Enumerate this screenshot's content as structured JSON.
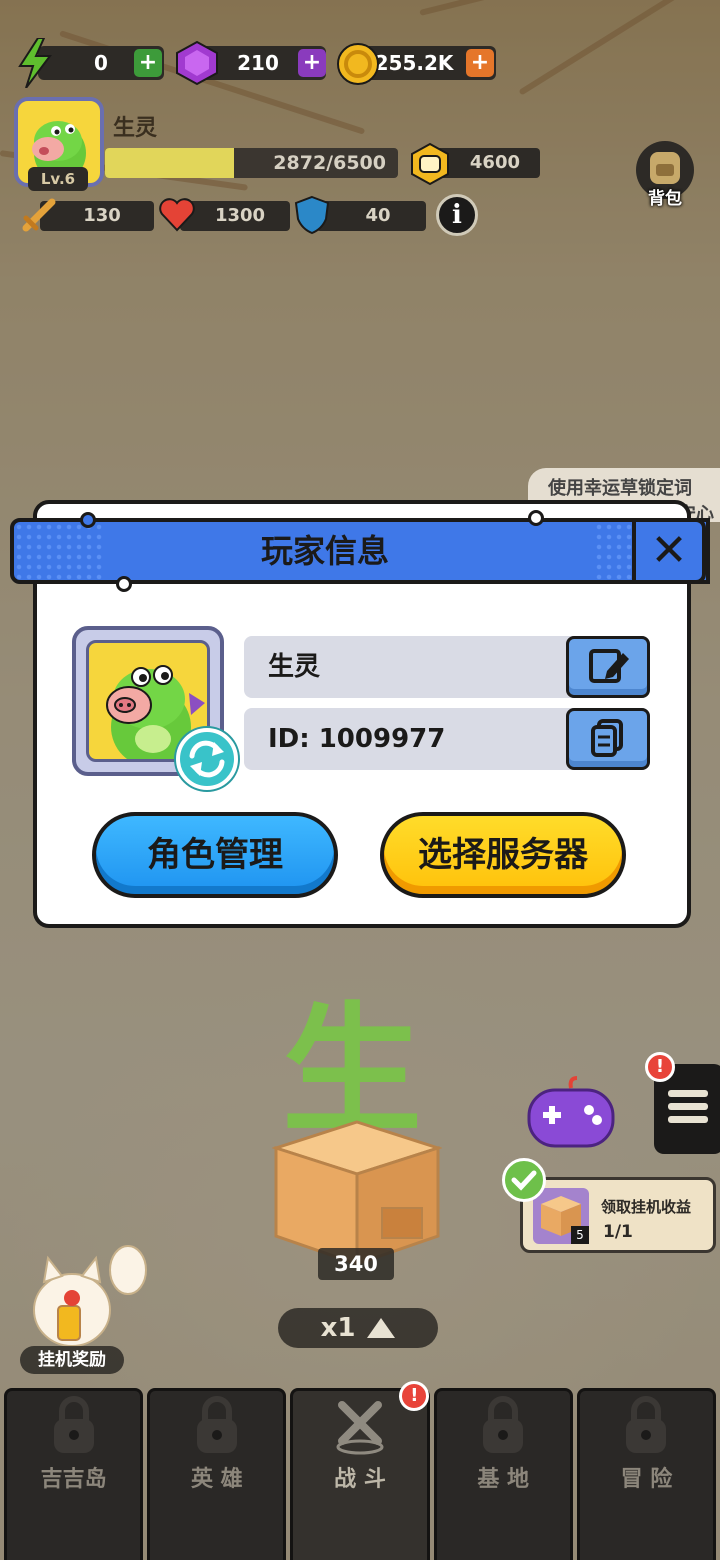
{
  "hud": {
    "energy": "0",
    "gems": "210",
    "coins": "255.2K",
    "player_name": "生灵",
    "level": "Lv.6",
    "xp_text": "2872/6500",
    "xp_progress": 0.4418,
    "power": "4600",
    "attack": "130",
    "hp": "1300",
    "defense": "40",
    "backpack_label": "背包",
    "plus_symbol": "+",
    "info_symbol": "i"
  },
  "scene": {
    "big_char": "生",
    "crate_count": "340",
    "speed_label": "x1",
    "idle_reward_label": "挂机奖励",
    "hint_text": "使用幸运草锁定词",
    "hint_text_2": "安心",
    "task_title": "领取挂机收益",
    "task_progress": "1/1",
    "task_badge": "5",
    "alert_symbol": "!"
  },
  "modal": {
    "title": "玩家信息",
    "close_symbol": "✕",
    "name_value": "生灵",
    "id_value": "ID: 1009977",
    "role_button": "角色管理",
    "server_button": "选择服务器"
  },
  "nav": {
    "items": [
      {
        "label": "吉吉岛"
      },
      {
        "label": "英 雄"
      },
      {
        "label": "战 斗"
      },
      {
        "label": "基 地"
      },
      {
        "label": "冒 险"
      }
    ]
  },
  "colors": {
    "modal_header": "#3f78e8",
    "blue_button": "#1e93f0",
    "yellow_button": "#ffc10a",
    "field_bg": "#d9dbe5"
  }
}
